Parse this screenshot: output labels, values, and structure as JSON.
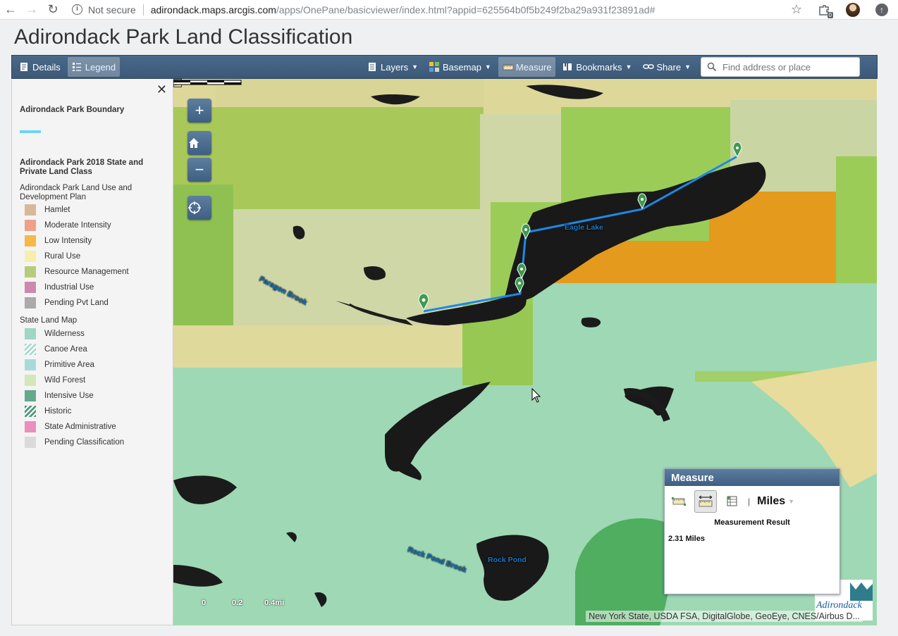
{
  "browser": {
    "back": "←",
    "forward": "→",
    "reload": "↻",
    "security_label": "Not secure",
    "url_host": "adirondack.maps.arcgis.com",
    "url_rest": "/apps/OnePane/basicviewer/index.html?appid=625564b0f5b249f2ba29a931f23891ad#",
    "extension_badge": "0"
  },
  "app": {
    "title": "Adirondack Park Land Classification"
  },
  "toolbar": {
    "details": "Details",
    "legend": "Legend",
    "layers": "Layers",
    "basemap": "Basemap",
    "measure": "Measure",
    "bookmarks": "Bookmarks",
    "share": "Share",
    "search_placeholder": "Find address or place"
  },
  "legend": {
    "close": "✕",
    "boundary_title": "Adirondack Park Boundary",
    "boundary_color": "#6ed5f0",
    "landclass_title": "Adirondack Park 2018 State and Private Land Class",
    "group1_title": "Adirondack Park Land Use and Development Plan",
    "group1_items": [
      {
        "label": "Hamlet",
        "color": "#d7b99a"
      },
      {
        "label": "Moderate Intensity",
        "color": "#f0a089"
      },
      {
        "label": "Low Intensity",
        "color": "#f5b94a"
      },
      {
        "label": "Rural Use",
        "color": "#f6eeac"
      },
      {
        "label": "Resource Management",
        "color": "#b7cc7a"
      },
      {
        "label": "Industrial Use",
        "color": "#cc88ad"
      },
      {
        "label": "Pending Pvt Land",
        "color": "#aaaaaa"
      }
    ],
    "group2_title": "State Land Map",
    "group2_items": [
      {
        "label": "Wilderness",
        "color": "#9fd6c5"
      },
      {
        "label": "Canoe Area",
        "color": "#a9dad0"
      },
      {
        "label": "Primitive Area",
        "color": "#a8dbd8"
      },
      {
        "label": "Wild Forest",
        "color": "#d4e7b9"
      },
      {
        "label": "Intensive Use",
        "color": "#64a98a"
      },
      {
        "label": "Historic",
        "color": "#4f9a7a"
      },
      {
        "label": "State Administrative",
        "color": "#ea8fbe"
      },
      {
        "label": "Pending Classification",
        "color": "#dadada"
      }
    ]
  },
  "map": {
    "labels": {
      "eagle_lake": "Eagle Lake",
      "paragon_brook": "Paragon Brook",
      "rock_pond_brook": "Rock Pond Brook",
      "rock_pond": "Rock Pond"
    },
    "scale_labels": [
      "0",
      "0.2",
      "0.4mi"
    ],
    "attribution": "New York State, USDA FSA, DigitalGlobe, GeoEye, CNES/Airbus D...",
    "logo_text": "Adirondack",
    "measure_line_color": "#1e88e5"
  },
  "measure": {
    "title": "Measure",
    "unit": "Miles",
    "result_title": "Measurement Result",
    "result_value": "2.31 Miles"
  }
}
